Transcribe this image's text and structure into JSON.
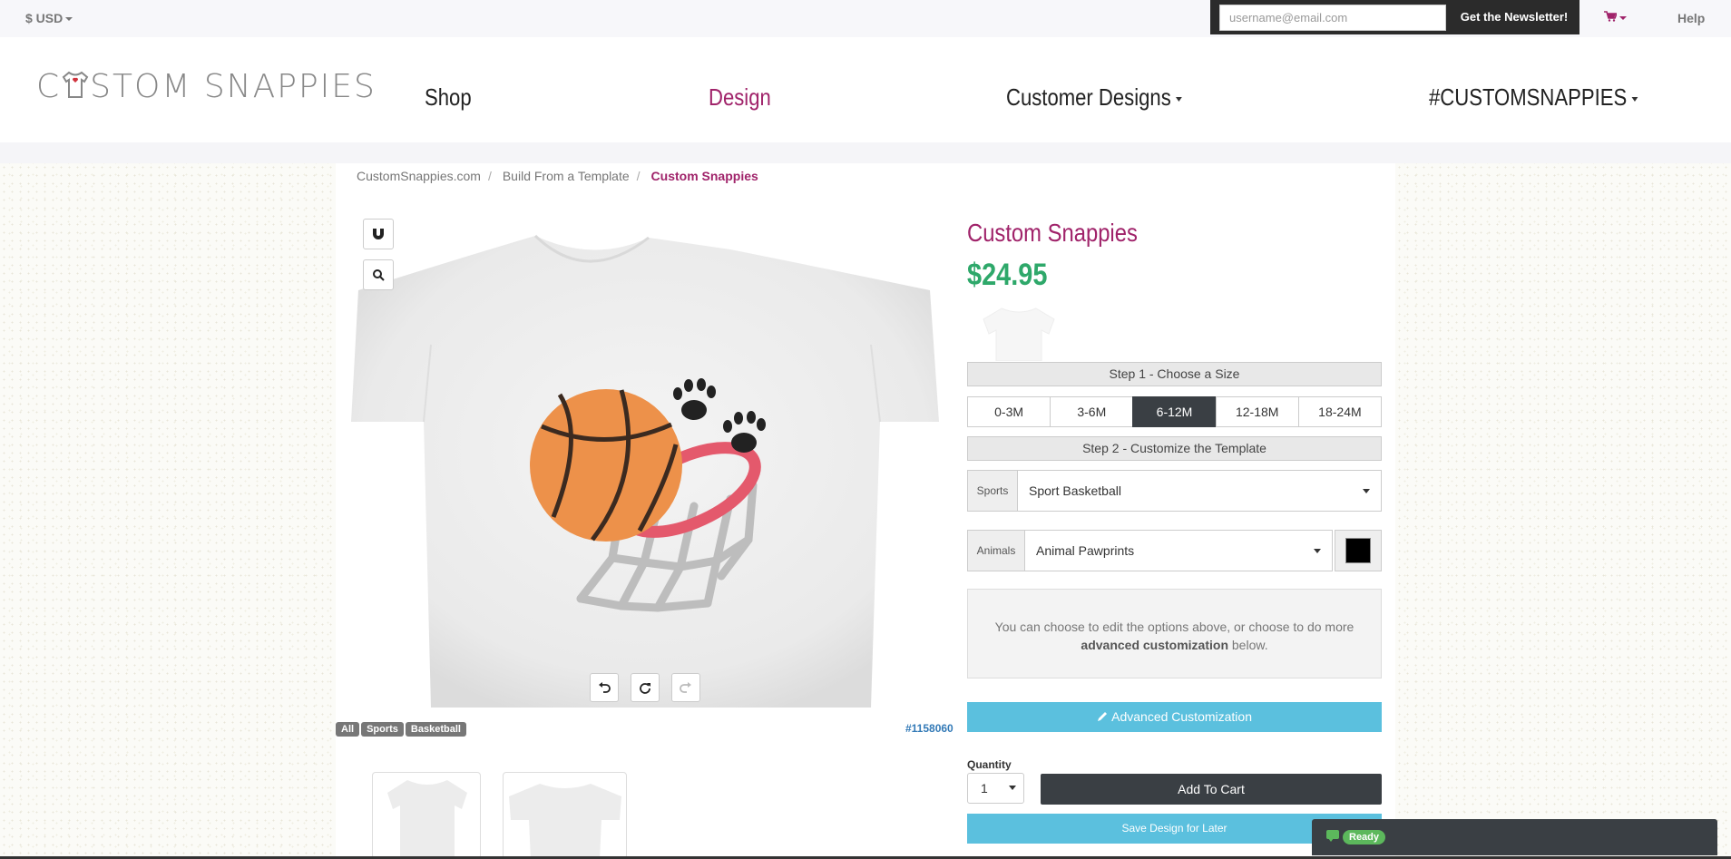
{
  "topbar": {
    "currency": "$ USD",
    "newsletter_placeholder": "username@email.com",
    "newsletter_button": "Get the Newsletter!",
    "help": "Help"
  },
  "header": {
    "logo": "CUSTOM SNAPPIES",
    "nav": {
      "shop": "Shop",
      "design": "Design",
      "customer_designs": "Customer Designs",
      "hashtag": "#CUSTOMSNAPPIES"
    }
  },
  "breadcrumb": {
    "home": "CustomSnappies.com",
    "parent": "Build From a Template",
    "current": "Custom Snappies",
    "sep": "/"
  },
  "product": {
    "title": "Custom Snappies",
    "price": "$24.95",
    "tags": [
      "All",
      "Sports",
      "Basketball"
    ],
    "design_id": "#1158060",
    "step1": "Step 1 - Choose a Size",
    "sizes": [
      "0-3M",
      "3-6M",
      "6-12M",
      "12-18M",
      "18-24M"
    ],
    "selected_size": "6-12M",
    "step2": "Step 2 - Customize the Template",
    "sports_label": "Sports",
    "sports_value": "Sport Basketball",
    "animals_label": "Animals",
    "animals_value": "Animal Pawprints",
    "animals_color": "#000000",
    "info_text_1": "You can choose to edit the options above, or choose to do more",
    "info_bold": "advanced customization",
    "info_text_2": "below.",
    "advanced_button": "Advanced Customization",
    "quantity_label": "Quantity",
    "quantity_value": "1",
    "add_to_cart": "Add To Cart",
    "save_design": "Save Design for Later"
  },
  "chat": {
    "status": "Ready"
  },
  "colors": {
    "brand": "#a0236a",
    "price": "#2ea86a",
    "info_button": "#5bc0de",
    "dark_button": "#3a3f44"
  }
}
